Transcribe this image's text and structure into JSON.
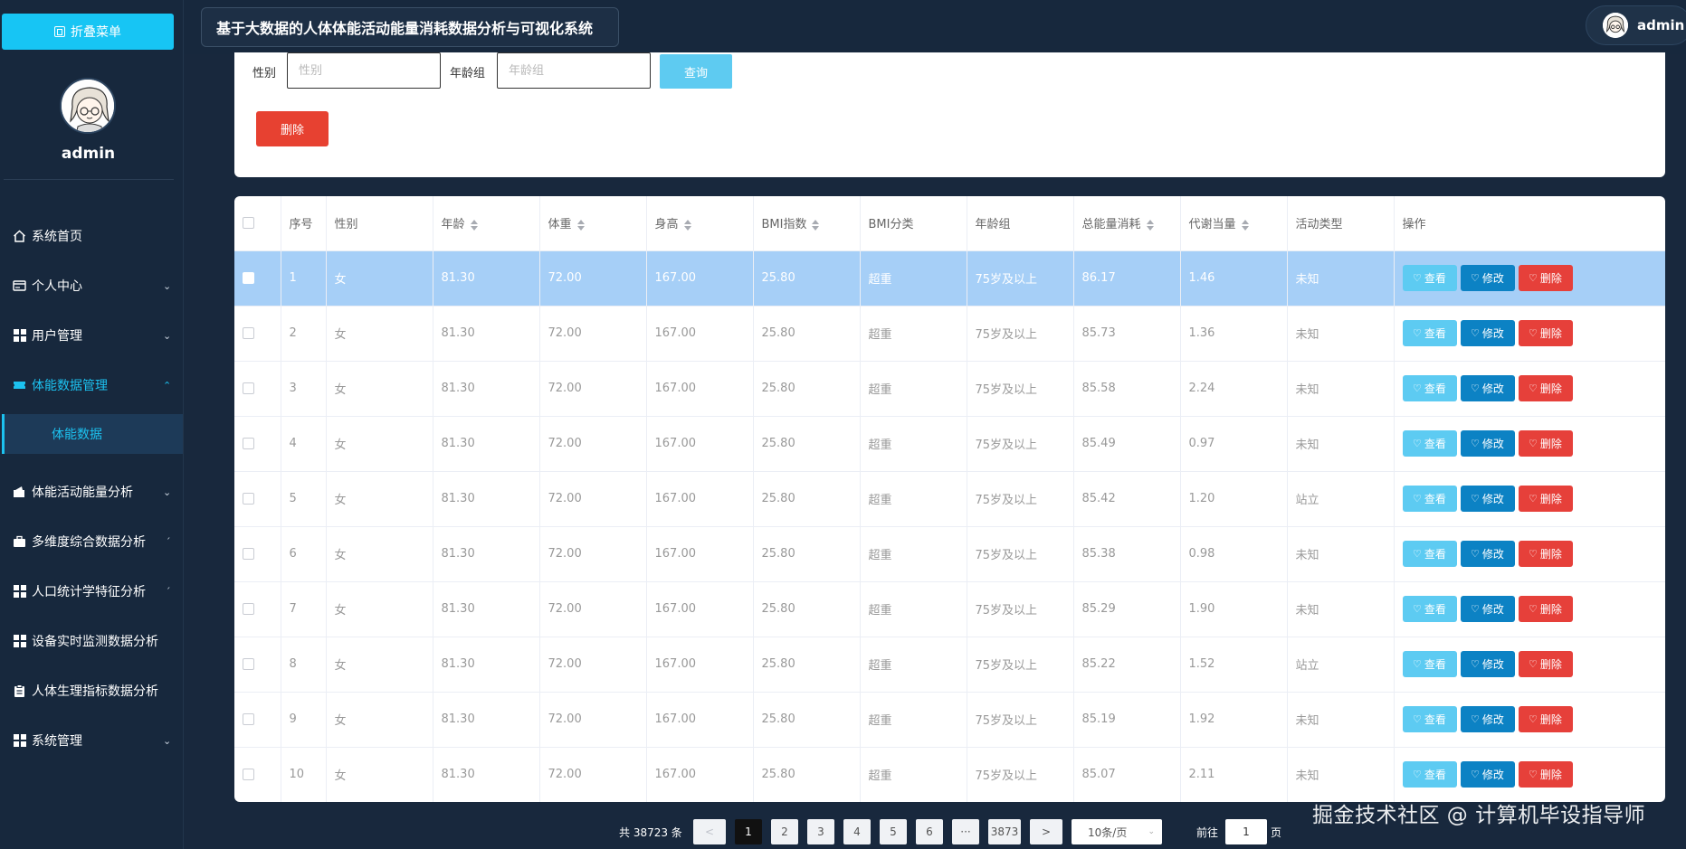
{
  "sidebar": {
    "collapse_label": "折叠菜单",
    "username": "admin",
    "menu": [
      {
        "label": "系统首页",
        "icon": "home-icon",
        "expandable": false
      },
      {
        "label": "个人中心",
        "icon": "card-icon",
        "expandable": true
      },
      {
        "label": "用户管理",
        "icon": "grid-icon",
        "expandable": true
      },
      {
        "label": "体能数据管理",
        "icon": "ticket-icon",
        "expandable": true,
        "active": true
      },
      {
        "label": "体能活动能量分析",
        "icon": "wallet-icon",
        "expandable": true
      },
      {
        "label": "多维度综合数据分析",
        "icon": "briefcase-icon",
        "expandable": true
      },
      {
        "label": "人口统计学特征分析",
        "icon": "grid-icon",
        "expandable": true
      },
      {
        "label": "设备实时监测数据分析",
        "icon": "grid-icon",
        "expandable": false
      },
      {
        "label": "人体生理指标数据分析",
        "icon": "clipboard-icon",
        "expandable": false
      },
      {
        "label": "系统管理",
        "icon": "grid-icon",
        "expandable": true
      }
    ],
    "submenu_active": "体能数据"
  },
  "header": {
    "title": "基于大数据的人体体能活动能量消耗数据分析与可视化系统",
    "user": "admin"
  },
  "search": {
    "gender_label": "性别",
    "gender_placeholder": "性别",
    "age_group_label": "年龄组",
    "age_group_placeholder": "年龄组",
    "query_label": "查询",
    "delete_label": "删除"
  },
  "table": {
    "columns": [
      "序号",
      "性别",
      "年龄",
      "体重",
      "身高",
      "BMI指数",
      "BMI分类",
      "年龄组",
      "总能量消耗",
      "代谢当量",
      "活动类型",
      "操作"
    ],
    "sortable": [
      false,
      false,
      true,
      true,
      true,
      true,
      false,
      false,
      true,
      true,
      false,
      false
    ],
    "rows": [
      [
        "1",
        "女",
        "81.30",
        "72.00",
        "167.00",
        "25.80",
        "超重",
        "75岁及以上",
        "86.17",
        "1.46",
        "未知"
      ],
      [
        "2",
        "女",
        "81.30",
        "72.00",
        "167.00",
        "25.80",
        "超重",
        "75岁及以上",
        "85.73",
        "1.36",
        "未知"
      ],
      [
        "3",
        "女",
        "81.30",
        "72.00",
        "167.00",
        "25.80",
        "超重",
        "75岁及以上",
        "85.58",
        "2.24",
        "未知"
      ],
      [
        "4",
        "女",
        "81.30",
        "72.00",
        "167.00",
        "25.80",
        "超重",
        "75岁及以上",
        "85.49",
        "0.97",
        "未知"
      ],
      [
        "5",
        "女",
        "81.30",
        "72.00",
        "167.00",
        "25.80",
        "超重",
        "75岁及以上",
        "85.42",
        "1.20",
        "站立"
      ],
      [
        "6",
        "女",
        "81.30",
        "72.00",
        "167.00",
        "25.80",
        "超重",
        "75岁及以上",
        "85.38",
        "0.98",
        "未知"
      ],
      [
        "7",
        "女",
        "81.30",
        "72.00",
        "167.00",
        "25.80",
        "超重",
        "75岁及以上",
        "85.29",
        "1.90",
        "未知"
      ],
      [
        "8",
        "女",
        "81.30",
        "72.00",
        "167.00",
        "25.80",
        "超重",
        "75岁及以上",
        "85.22",
        "1.52",
        "站立"
      ],
      [
        "9",
        "女",
        "81.30",
        "72.00",
        "167.00",
        "25.80",
        "超重",
        "75岁及以上",
        "85.19",
        "1.92",
        "未知"
      ],
      [
        "10",
        "女",
        "81.30",
        "72.00",
        "167.00",
        "25.80",
        "超重",
        "75岁及以上",
        "85.07",
        "2.11",
        "未知"
      ]
    ],
    "selected_row": 0,
    "actions": {
      "view": "查看",
      "edit": "修改",
      "delete": "删除"
    }
  },
  "pagination": {
    "total": "共 38723 条",
    "prev": "<",
    "pages": [
      "1",
      "2",
      "3",
      "4",
      "5",
      "6",
      "···",
      "3873"
    ],
    "current": "1",
    "next": ">",
    "page_size": "10条/页",
    "goto_label": "前往",
    "goto_value": "1",
    "goto_unit": "页"
  },
  "watermark": "掘金技术社区 @ 计算机毕设指导师"
}
